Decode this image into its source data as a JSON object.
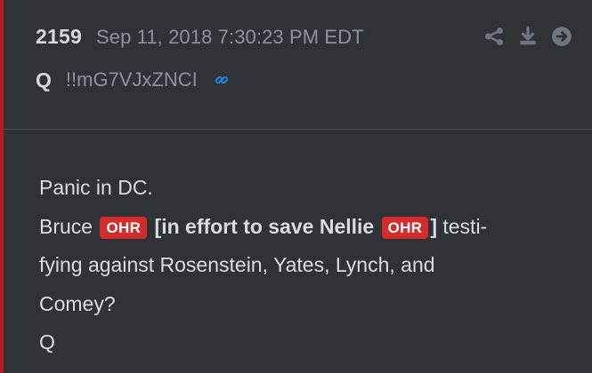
{
  "post": {
    "number": "2159",
    "date": "Sep 11, 2018 7:30:23 PM EDT",
    "author": "Q",
    "tripcode": "!!mG7VJxZNCI",
    "accent_color": "#b71c1c",
    "tag_color": "#d42b2b",
    "link_color": "#1e88e5"
  },
  "actions": {
    "icons": [
      "share-icon",
      "download-icon",
      "arrow-right-circle-icon"
    ]
  },
  "message": {
    "line1": "Panic in DC.",
    "line2_a": "Bruce ",
    "tag1": "OHR",
    "line2_b": " [in effort to save Nellie ",
    "tag2": "OHR",
    "line2_c": "]",
    "line2_d": " testi-",
    "line3": "fying against Rosenstein, Yates, Lynch, and",
    "line4": "Comey?",
    "line5": "Q"
  }
}
